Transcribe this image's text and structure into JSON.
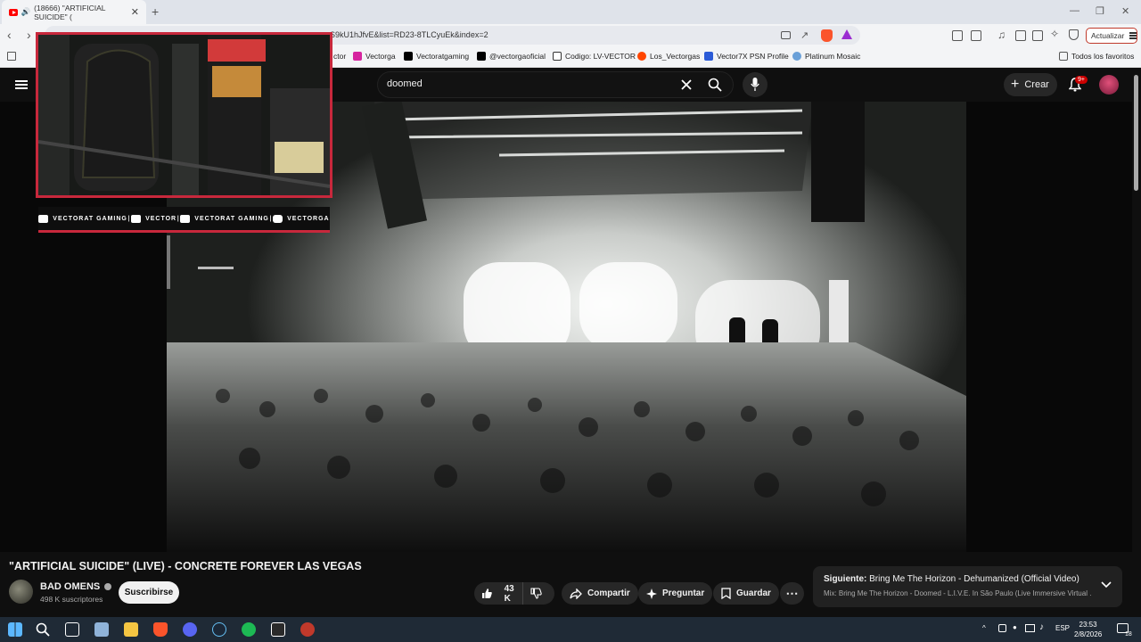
{
  "browser": {
    "tab_title": "(18666) \"ARTIFICIAL SUICIDE\" (",
    "url": "S9kU1hJfvE&list=RD23-8TLCyuEk&index=2",
    "update_label": "Actualizar",
    "bookmarks": [
      {
        "label": "ctor",
        "color": "#888888"
      },
      {
        "label": "Vectorga",
        "color": "#d6249f"
      },
      {
        "label": "Vectoratgaming",
        "color": "#000000"
      },
      {
        "label": "@vectorgaoficial",
        "color": "#000000"
      },
      {
        "label": "Codigo: LV-VECTOR",
        "color": "#333333"
      },
      {
        "label": "Los_Vectorgas",
        "color": "#ff4500"
      },
      {
        "label": "Vector7X PSN Profile",
        "color": "#2b5bd7"
      },
      {
        "label": "Platinum Mosaic",
        "color": "#6aa0d8"
      }
    ],
    "favorites_label": "Todos los favoritos"
  },
  "youtube": {
    "search_value": "doomed",
    "create_label": "Crear",
    "notif_badge": "9+",
    "video_title": "\"ARTIFICIAL SUICIDE\" (LIVE) - CONCRETE FOREVER LAS VEGAS",
    "channel_name": "BAD OMENS",
    "subscribers": "498 K suscriptores",
    "subscribe_label": "Suscribirse",
    "likes": "43 K",
    "share_label": "Compartir",
    "ask_label": "Preguntar",
    "save_label": "Guardar",
    "upnext_prefix": "Siguiente:",
    "upnext_title": "Bring Me The Horizon - Dehumanized (Official Video)",
    "upnext_mix": "Mix: Bring Me The Horizon - Doomed - L.I.V.E. In São Paulo (Live Immersive Virtual ..."
  },
  "overlay": {
    "socials": [
      "VECTORAT GAMING",
      "VECTOR",
      "VECTORAT GAMING",
      "VECTORGA"
    ]
  },
  "taskbar": {
    "lang": "ESP",
    "time": "23:53",
    "date": "2/8/2026",
    "notif_count": "18"
  },
  "colors": {
    "accent_red": "#c8283c",
    "yt_bg": "#0f0f0f"
  }
}
